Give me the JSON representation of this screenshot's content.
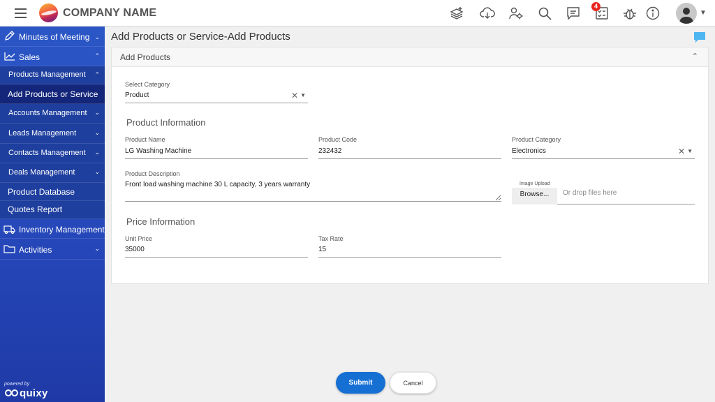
{
  "topbar": {
    "company_name": "COMPANY NAME",
    "notification_count": "4",
    "icons": [
      "menu-icon",
      "layers-add-icon",
      "cloud-download-icon",
      "user-settings-icon",
      "search-icon",
      "chat-icon",
      "checklist-icon",
      "bug-icon",
      "info-icon",
      "user-avatar-icon"
    ]
  },
  "sidebar": {
    "items": [
      {
        "label": "Minutes of Meeting",
        "icon": "pencil-icon"
      },
      {
        "label": "Sales",
        "icon": "chart-line-icon"
      },
      {
        "label": "Products Management"
      },
      {
        "label": "Add Products or Service"
      },
      {
        "label": "Accounts Management"
      },
      {
        "label": "Leads Management"
      },
      {
        "label": "Contacts Management"
      },
      {
        "label": "Deals Management"
      },
      {
        "label": "Product Database"
      },
      {
        "label": "Quotes Report"
      },
      {
        "label": "Inventory Management",
        "icon": "truck-icon"
      },
      {
        "label": "Activities",
        "icon": "folder-icon"
      }
    ],
    "powered_by": "powered by",
    "brand": "quixy"
  },
  "page": {
    "title": "Add Products or Service-Add Products"
  },
  "panel": {
    "title": "Add Products",
    "category": {
      "label": "Select Category",
      "value": "Product"
    },
    "product_info": {
      "heading": "Product Information",
      "name": {
        "label": "Product Name",
        "value": "LG Washing Machine"
      },
      "code": {
        "label": "Product Code",
        "value": "232432"
      },
      "category": {
        "label": "Product Category",
        "value": "Electronics"
      },
      "description": {
        "label": "Product Description",
        "value": "Front load washing machine 30 L capacity, 3 years warranty"
      },
      "upload": {
        "label": "Image Upload",
        "browse": "Browse...",
        "drop": "Or drop files here"
      }
    },
    "price_info": {
      "heading": "Price Information",
      "unit_price": {
        "label": "Unit Price",
        "value": "35000"
      },
      "tax_rate": {
        "label": "Tax Rate",
        "value": "15"
      }
    }
  },
  "actions": {
    "submit": "Submit",
    "cancel": "Cancel"
  },
  "colors": {
    "sidebar": "#2b56c6",
    "primary": "#1670d4",
    "badge": "#e8261e"
  }
}
